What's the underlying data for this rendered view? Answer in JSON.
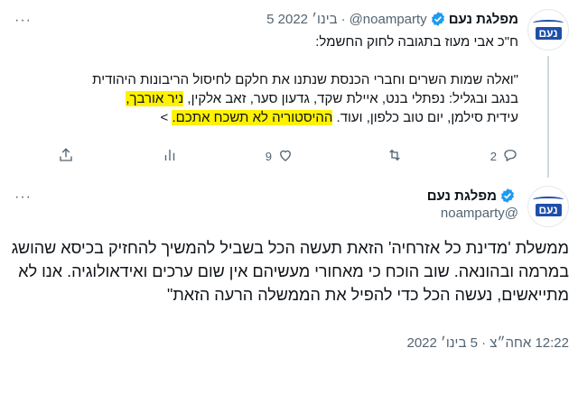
{
  "tweet1": {
    "name": "מפלגת נעם",
    "handle": "@noamparty",
    "separator": "·",
    "date": "5 בינו׳ 2022",
    "intro": "ח\"כ אבי מעוז בתגובה לחוק החשמל:",
    "quote_line1": "\"ואלה שמות השרים וחברי הכנסת שנתנו את חלקם לחיסול הריבונות היהודית",
    "quote_line2_prefix": "בנגב ובגליל: נפתלי בנט, איילת שקד, גדעון סער, זאב אלקין, ",
    "quote_line2_highlight": "ניר אורבך,",
    "quote_line3_prefix": "עידית סילמן, יום טוב כלפון, ועוד. ",
    "quote_line3_highlight": "ההיסטוריה לא תשכח אתכם.",
    "quote_line3_suffix": " >",
    "more": "···",
    "actions": {
      "reply_count": "2",
      "retweet_count": "",
      "like_count": "9",
      "icons": [
        "reply-icon",
        "retweet-icon",
        "like-icon",
        "analytics-icon",
        "share-icon"
      ]
    }
  },
  "tweet2": {
    "name": "מפלגת נעם",
    "handle": "@noamparty",
    "more": "···",
    "body": "ממשלת 'מדינת כל אזרחיה' הזאת תעשה הכל בשביל להמשיך להחזיק בכיסא שהושג במרמה ובהונאה. שוב הוכח כי מאחורי מעשיהם אין שום ערכים ואידאולוגיה. אנו לא מתייאשים, נעשה הכל כדי להפיל את הממשלה הרעה הזאת\"",
    "timestamp": "12:22 אחה״צ · 5 בינו׳ 2022"
  },
  "avatar": {
    "logo_text": "נעם"
  },
  "colors": {
    "verified": "#1d9bf0",
    "highlight": "#fff200",
    "brand": "#1e4fa8"
  }
}
